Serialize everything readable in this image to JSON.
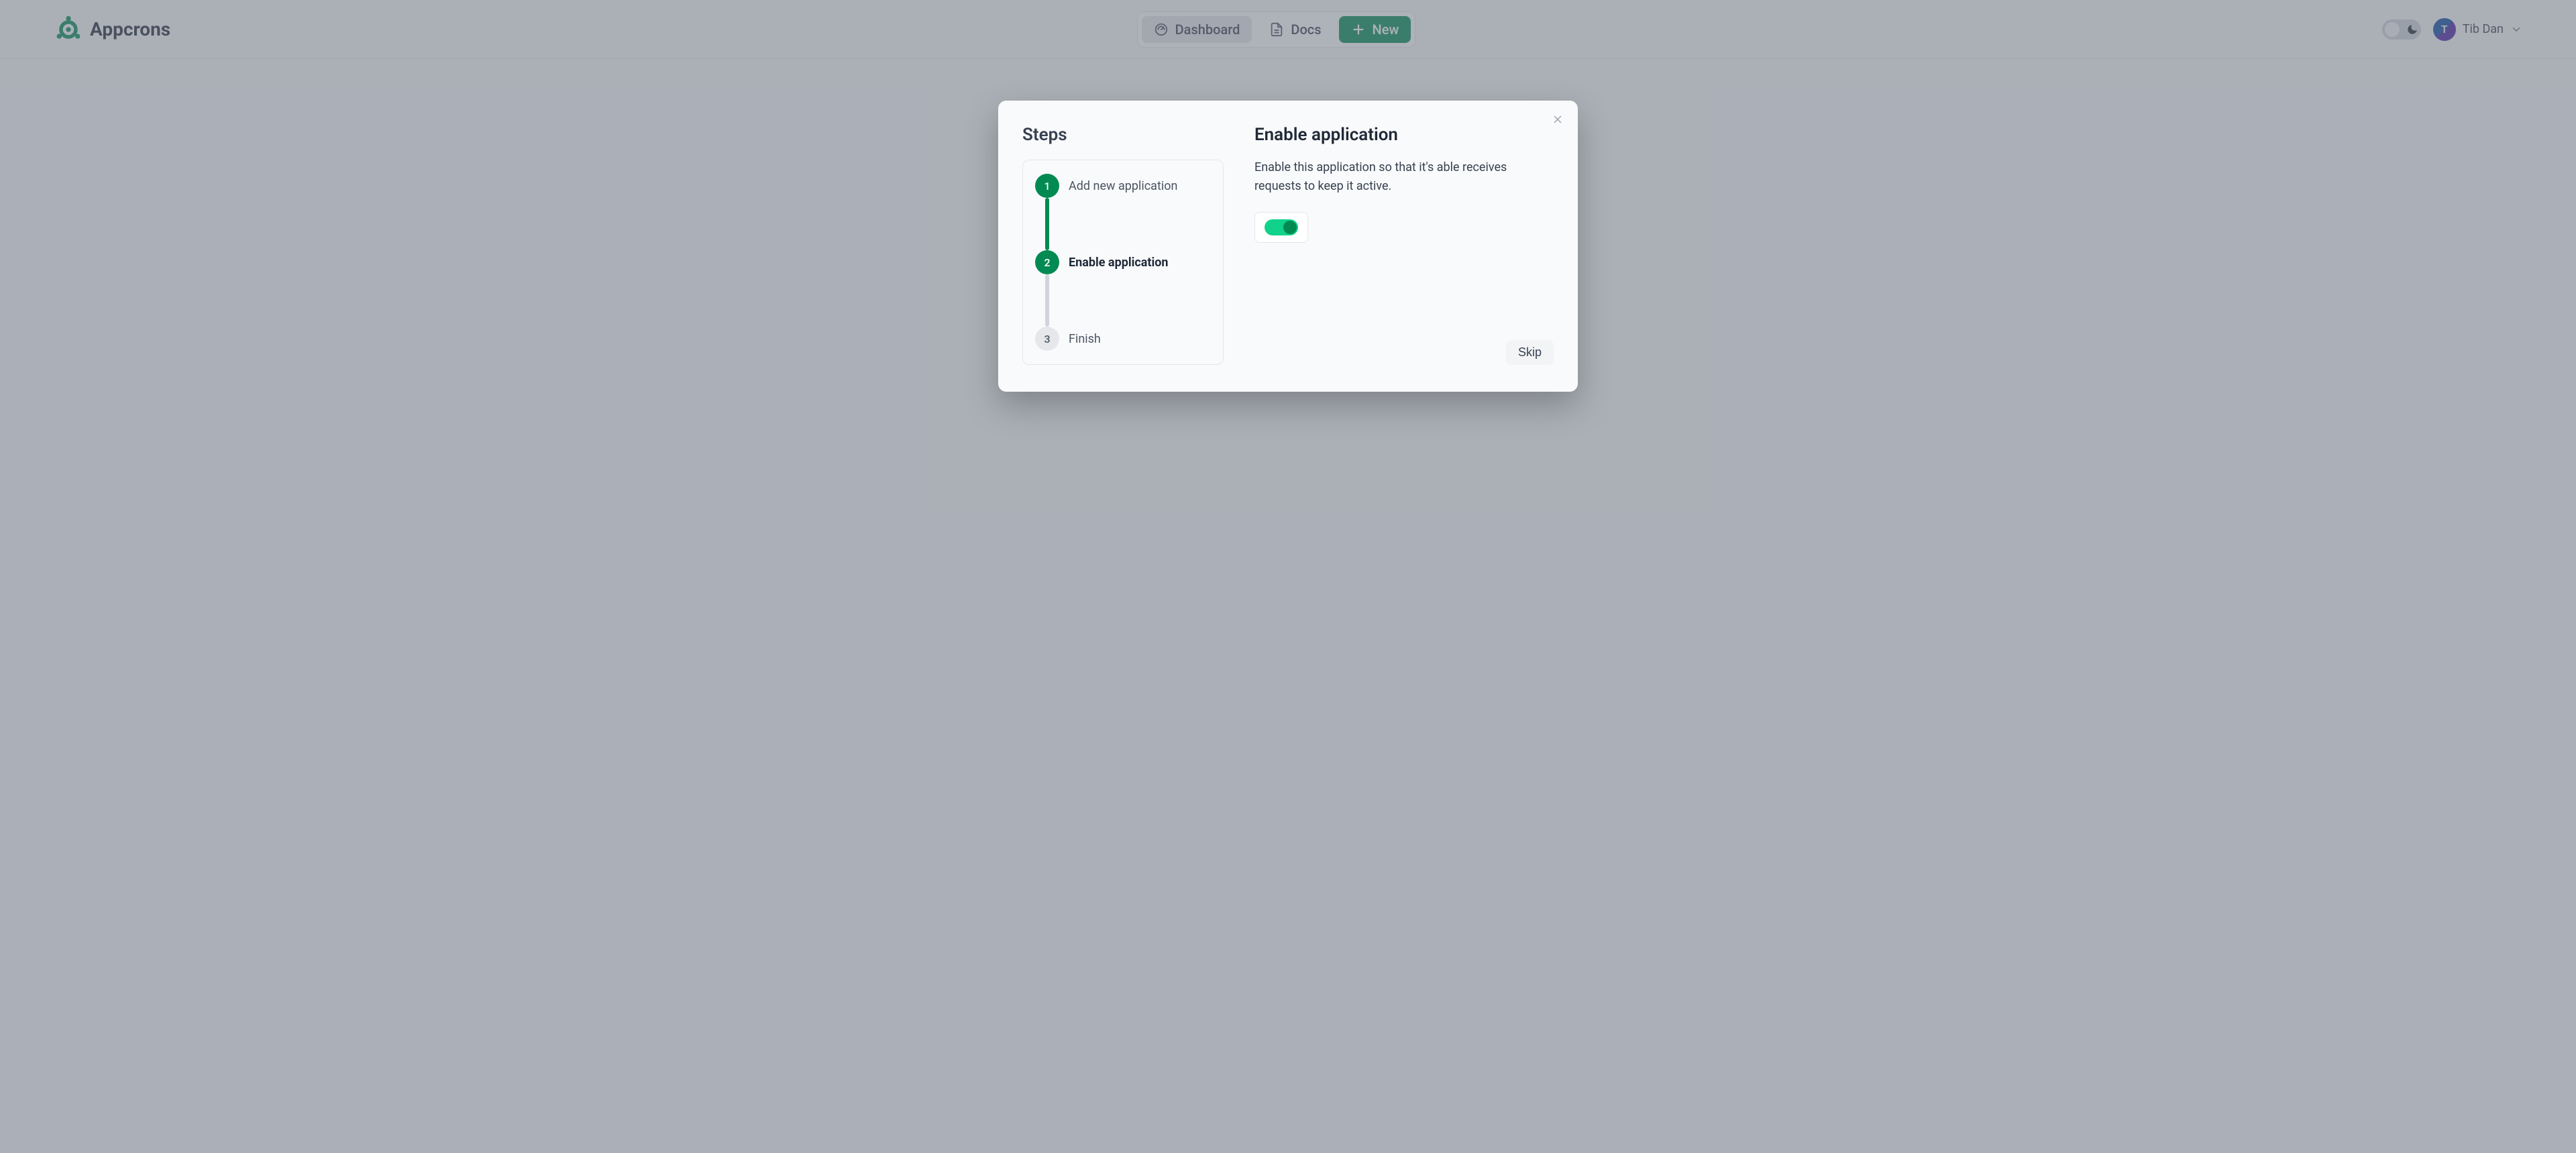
{
  "brand": {
    "name": "Appcrons"
  },
  "nav": {
    "dashboard_label": "Dashboard",
    "docs_label": "Docs",
    "new_label": "New",
    "active": "dashboard"
  },
  "user": {
    "display_name": "Tib Dan",
    "avatar_initial": "T"
  },
  "theme": {
    "mode": "light"
  },
  "modal": {
    "steps_heading": "Steps",
    "steps": [
      {
        "num": "1",
        "label": "Add new application",
        "state": "done"
      },
      {
        "num": "2",
        "label": "Enable application",
        "state": "active"
      },
      {
        "num": "3",
        "label": "Finish",
        "state": "pending"
      }
    ],
    "title": "Enable application",
    "description": "Enable this application so that it's able receives requests to keep it active.",
    "toggle_on": true,
    "skip_label": "Skip"
  },
  "colors": {
    "accent": "#028a52",
    "accent_light": "#10d28a"
  }
}
